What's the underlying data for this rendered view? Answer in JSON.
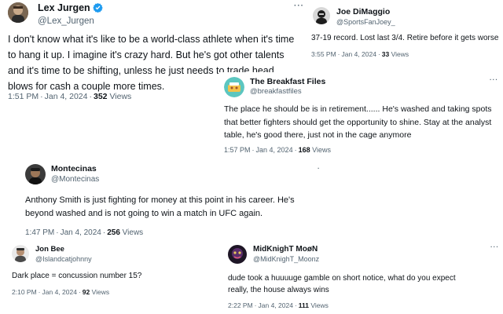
{
  "tweets": [
    {
      "name": "Lex Jurgen",
      "handle": "@Lex_Jurgen",
      "text": "I don't know what it's like to be a world-class athlete when it's time to hang it up. I imagine it's crazy hard. But he's got other talents and it's time to be shifting, unless he just needs to trade head blows for cash a couple more times.",
      "time": "1:51 PM",
      "date": "Jan 4, 2024",
      "views_count": "352",
      "views_label": "Views",
      "more": "···"
    },
    {
      "name": "Joe DiMaggio",
      "handle": "@SportsFanJoey_",
      "text": "37-19 record. Lost last 3/4. Retire before it gets worse",
      "time": "3:55 PM",
      "date": "Jan 4, 2024",
      "views_count": "33",
      "views_label": "Views"
    },
    {
      "name": "The Breakfast Files",
      "handle": "@breakfastfiles",
      "text": "The place he should be is in retirement...... He's washed and taking spots that better fighters should get the opportunity to shine. Stay at the analyst table, he's good there, just not in the cage anymore",
      "time": "1:57 PM",
      "date": "Jan 4, 2024",
      "views_count": "168",
      "views_label": "Views",
      "more": "···"
    },
    {
      "name": "Montecinas",
      "handle": "@Montecinas",
      "text": "Anthony Smith is just fighting for money at this point in his career. He's beyond washed and is not going to win a match in UFC again.",
      "time": "1:47 PM",
      "date": "Jan 4, 2024",
      "views_count": "256",
      "views_label": "Views"
    },
    {
      "name": "Jon Bee",
      "handle": "@Islandcatjohnny",
      "text": "Dark place = concussion number 15?",
      "time": "2:10 PM",
      "date": "Jan 4, 2024",
      "views_count": "92",
      "views_label": "Views"
    },
    {
      "name": "MidKnighT MoøN",
      "handle": "@MidKnighT_Moonz",
      "text": "dude took a huuuuge gamble on short notice, what do you expect really, the house always wins",
      "time": "2:22 PM",
      "date": "Jan 4, 2024",
      "views_count": "111",
      "views_label": "Views",
      "more": "···"
    }
  ],
  "colors": {
    "text": "#0f1419",
    "secondary": "#536471",
    "verified": "#1d9bf0"
  }
}
